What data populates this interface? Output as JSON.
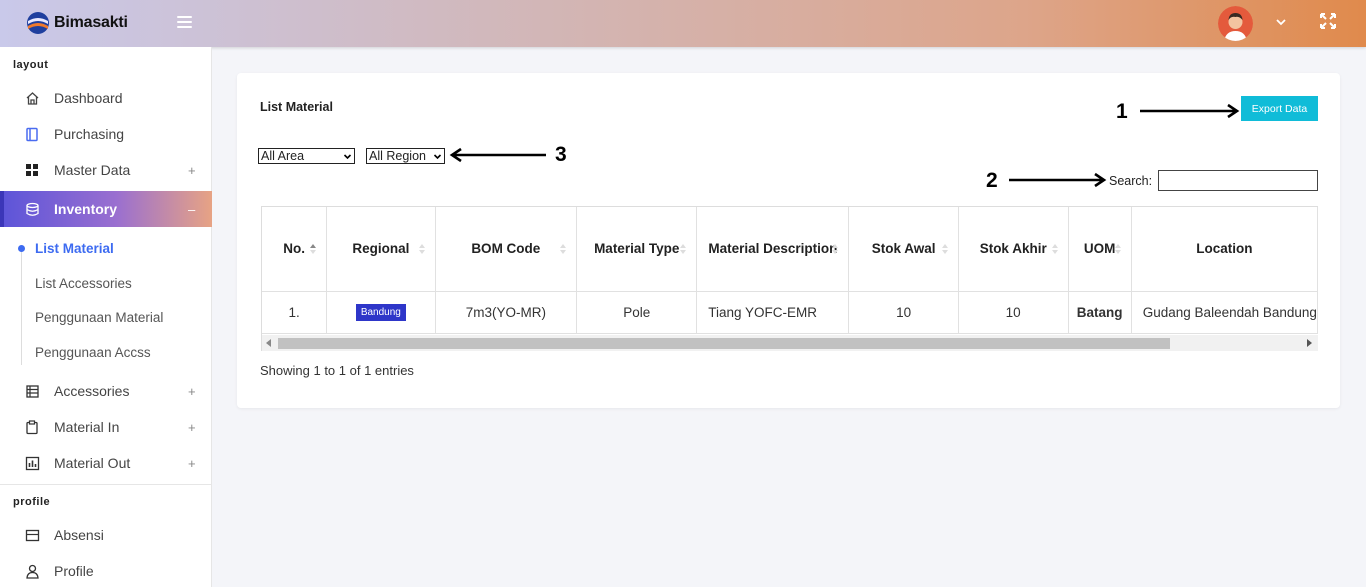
{
  "header": {
    "brand": "Bimasakti"
  },
  "sidebar": {
    "sections": [
      {
        "title": "layout"
      },
      {
        "title": "profile"
      }
    ],
    "items": [
      {
        "label": "Dashboard",
        "icon": "home-icon",
        "expand": ""
      },
      {
        "label": "Purchasing",
        "icon": "notebook-icon",
        "expand": ""
      },
      {
        "label": "Master Data",
        "icon": "grid-icon",
        "expand": "+"
      },
      {
        "label": "Inventory",
        "icon": "database-icon",
        "expand": "–"
      },
      {
        "label": "Accessories",
        "icon": "list-icon",
        "expand": "+"
      },
      {
        "label": "Material In",
        "icon": "clipboard-icon",
        "expand": "+"
      },
      {
        "label": "Material Out",
        "icon": "chart-icon",
        "expand": "+"
      },
      {
        "label": "Absensi",
        "icon": "calendar-icon",
        "expand": ""
      },
      {
        "label": "Profile",
        "icon": "user-icon",
        "expand": ""
      }
    ],
    "subitems": [
      {
        "label": "List Material",
        "active": true
      },
      {
        "label": "List Accessories"
      },
      {
        "label": "Penggunaan Material"
      },
      {
        "label": "Penggunaan Accss"
      }
    ]
  },
  "main": {
    "title": "List Material",
    "export_label": "Export Data",
    "area_select": "All Area",
    "region_select": "All Region",
    "search_label": "Search:",
    "search_value": "",
    "annotations": [
      "1",
      "2",
      "3"
    ],
    "columns": [
      "No.",
      "Regional",
      "BOM Code",
      "Material Type",
      "Material Description",
      "Stok Awal",
      "Stok Akhir",
      "UOM",
      "Location"
    ],
    "rows": [
      {
        "no": "1.",
        "regional": "Bandung",
        "bom": "7m3(YO-MR)",
        "type": "Pole",
        "desc": "Tiang YOFC-EMR",
        "awal": "10",
        "akhir": "10",
        "uom": "Batang",
        "location": "Gudang Baleendah Bandung"
      }
    ],
    "info": "Showing 1 to 1 of 1 entries"
  },
  "colors": {
    "accent": "#10bcd8",
    "badge": "#2e36c9",
    "link_active": "#3d6bf1"
  }
}
